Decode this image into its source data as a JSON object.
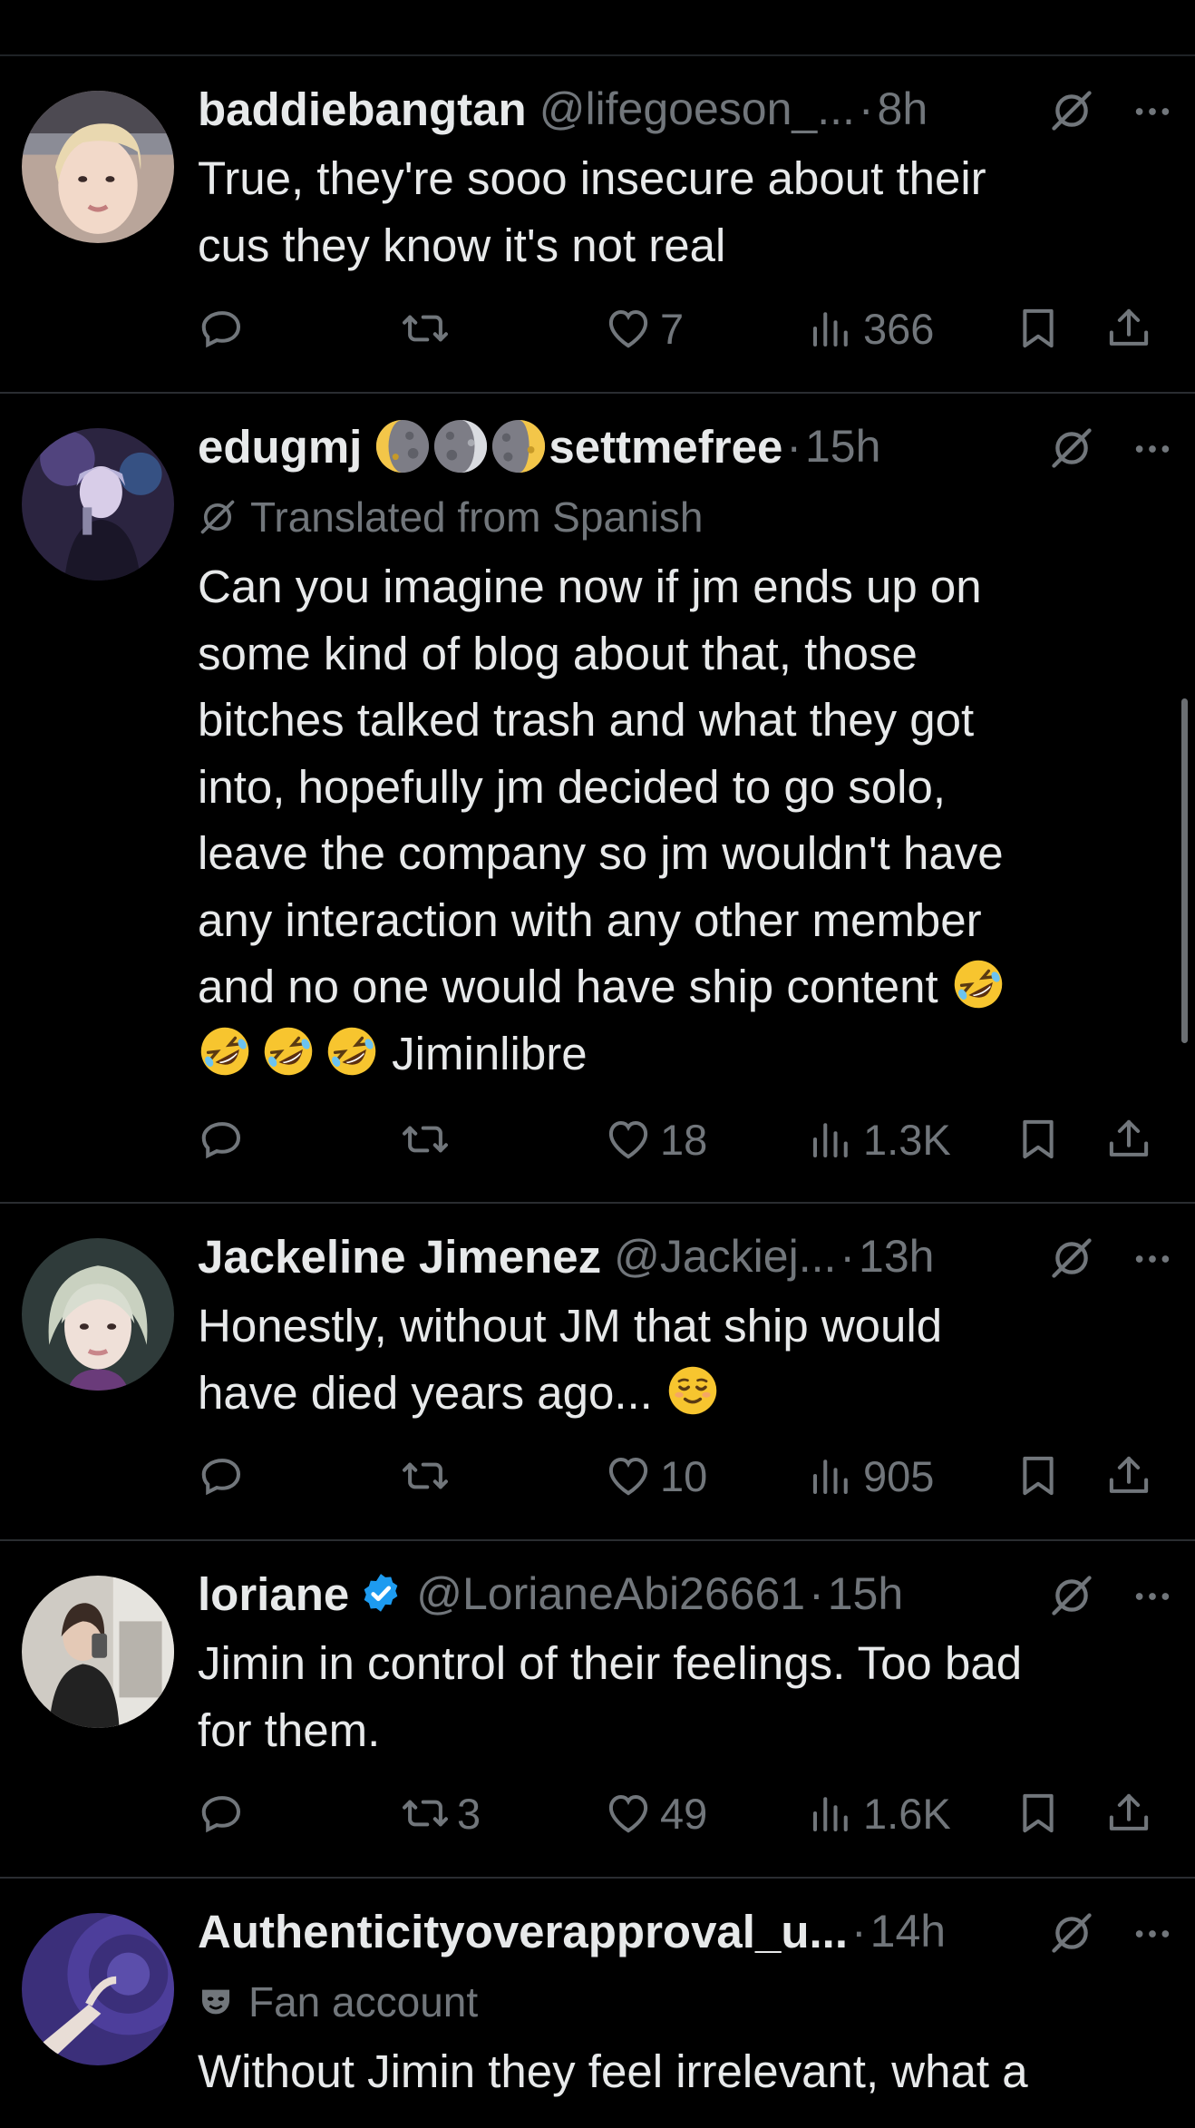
{
  "tweets": [
    {
      "name": "baddiebangtan",
      "handle": "@lifegoeson_...",
      "time": "8h",
      "lines": [
        "True, they're sooo insecure about their",
        "cus they know it's not real"
      ],
      "reply": "",
      "retweet": "",
      "like": "7",
      "views": "366"
    },
    {
      "name": "edugmj",
      "name_suffix": "settmefree",
      "time": "15h",
      "subline": "Translated from Spanish",
      "lines": [
        "Can you imagine now if jm ends up on",
        "some kind of blog about that, those",
        "bitches talked trash and what they got",
        "into, hopefully jm decided to go solo,",
        "leave the company so jm wouldn't have",
        "any interaction with any other member",
        "and no one would have ship content",
        "Jiminlibre"
      ],
      "reply": "",
      "retweet": "",
      "like": "18",
      "views": "1.3K"
    },
    {
      "name": "Jackeline Jimenez",
      "handle": "@Jackiej...",
      "time": "13h",
      "lines": [
        "Honestly, without JM that ship would",
        "have died years ago..."
      ],
      "reply": "",
      "retweet": "",
      "like": "10",
      "views": "905"
    },
    {
      "name": "loriane",
      "handle": "@LorianeAbi26661",
      "time": "15h",
      "lines": [
        "Jimin in control of their feelings. Too bad",
        "for them."
      ],
      "reply": "",
      "retweet": "3",
      "like": "49",
      "views": "1.6K"
    },
    {
      "name": "Authenticityoverapproval_u...",
      "time": "14h",
      "subline": "Fan account",
      "lines": [
        "Without Jimin they feel irrelevant, what a"
      ]
    }
  ],
  "separator": "·",
  "icons": [
    "grok-icon",
    "more-icon",
    "reply-icon",
    "retweet-icon",
    "like-icon",
    "views-icon",
    "bookmark-icon",
    "share-icon",
    "verified-badge-icon",
    "moon-emoji",
    "rofl-emoji",
    "relieved-emoji",
    "fan-mask-icon"
  ],
  "colors": {
    "background": "#000000",
    "text": "#e7e9ea",
    "muted": "#71767b",
    "verified": "#1d9bf0",
    "divider": "#2a2d31"
  }
}
